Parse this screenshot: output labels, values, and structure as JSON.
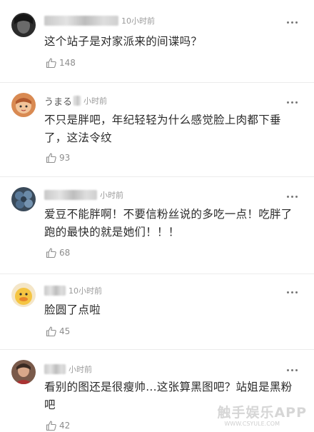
{
  "colors": {
    "text": "#2a2a2a",
    "meta": "#9a9a9a",
    "divider": "#ececec"
  },
  "comments": [
    {
      "name": "",
      "time": "10小时前",
      "text": "这个站子是对家派来的间谍吗？",
      "likes": "148",
      "avatar": "dark-face"
    },
    {
      "name": "うまる",
      "time": "小时前",
      "text": "不只是胖吧，年纪轻轻为什么感觉脸上肉都下垂了，这法令纹",
      "likes": "93",
      "avatar": "orange-character"
    },
    {
      "name": "",
      "time": "小时前",
      "text": "爱豆不能胖啊！不要信粉丝说的多吃一点！吃胖了跑的最快的就是她们！！！",
      "likes": "68",
      "avatar": "blue-berries"
    },
    {
      "name": "",
      "time": "10小时前",
      "text": "脸圆了点啦",
      "likes": "45",
      "avatar": "yellow-duck"
    },
    {
      "name": "",
      "time": "小时前",
      "text": "看别的图还是很瘦帅...这张算黑图吧？站姐是黑粉吧",
      "likes": "42",
      "avatar": "person-photo"
    }
  ],
  "watermark": {
    "main": "触手娱乐APP",
    "sub": "WWW.CSYULE.COM"
  }
}
